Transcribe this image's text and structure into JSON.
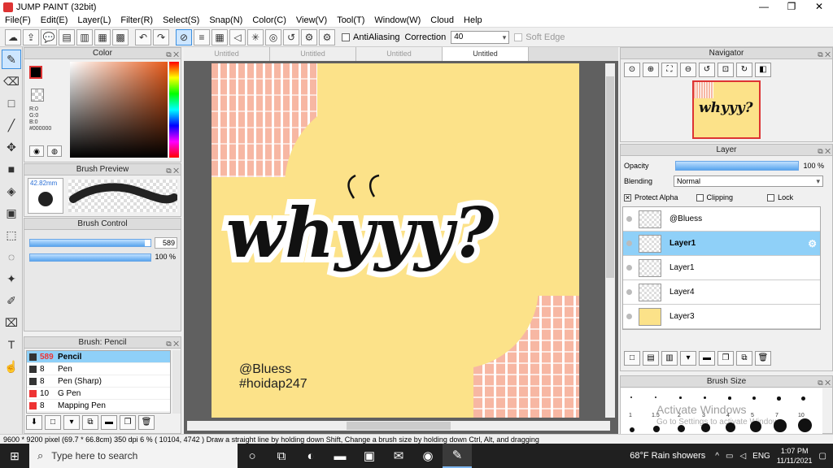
{
  "window": {
    "title": "JUMP PAINT (32bit)",
    "minimize": "—",
    "restore": "❐",
    "close": "✕"
  },
  "menu": [
    "File(F)",
    "Edit(E)",
    "Layer(L)",
    "Filter(R)",
    "Select(S)",
    "Snap(N)",
    "Color(C)",
    "View(V)",
    "Tool(T)",
    "Window(W)",
    "Cloud",
    "Help"
  ],
  "toolbar": {
    "antialiasing_label": "AntiAliasing",
    "correction_label": "Correction",
    "correction_value": "40",
    "soft_edge_label": "Soft Edge"
  },
  "color_panel": {
    "title": "Color",
    "r": "R:0",
    "g": "G:0",
    "b": "B:0",
    "hex": "#000000",
    "fg": "#000000",
    "bg": "#ffe680"
  },
  "brush_preview": {
    "title": "Brush Preview",
    "size": "42.82mm"
  },
  "brush_control": {
    "title": "Brush Control",
    "size_value": "589",
    "size_fraction": 0.95,
    "opacity_value": "100 %",
    "opacity_fraction": 1.0
  },
  "brush_list": {
    "title": "Brush: Pencil",
    "items": [
      {
        "size": "589",
        "name": "Pencil",
        "active": true
      },
      {
        "size": "8",
        "name": "Pen"
      },
      {
        "size": "8",
        "name": "Pen (Sharp)"
      },
      {
        "size": "10",
        "name": "G Pen"
      },
      {
        "size": "8",
        "name": "Mapping Pen"
      }
    ]
  },
  "canvas": {
    "tabs": [
      "Untitled",
      "Untitled",
      "Untitled",
      "Untitled"
    ],
    "active_tab": 3,
    "artwork_text": "whyyy?",
    "signature_line1": "@Bluess",
    "signature_line2": "#hoidap247"
  },
  "navigator": {
    "title": "Navigator",
    "thumb_text": "whyyy?"
  },
  "layer_panel": {
    "title": "Layer",
    "opacity_label": "Opacity",
    "opacity_value": "100 %",
    "opacity_fraction": 1.0,
    "blending_label": "Blending",
    "blending_value": "Normal",
    "protect_alpha_label": "Protect Alpha",
    "clipping_label": "Clipping",
    "lock_label": "Lock",
    "layers": [
      {
        "name": "@Bluess"
      },
      {
        "name": "Layer1",
        "active": true
      },
      {
        "name": "Layer1"
      },
      {
        "name": "Layer4"
      },
      {
        "name": "Layer3",
        "thumb": "yellow"
      }
    ]
  },
  "brush_size": {
    "title": "Brush Size",
    "labels": [
      "1",
      "1.5",
      "2",
      "3",
      "4",
      "5",
      "7",
      "10"
    ],
    "watermark_title": "Activate Windows",
    "watermark_sub": "Go to Settings to activate Windows."
  },
  "status": {
    "text": "9600 * 9200 pixel   (69.7 * 66.8cm)   350 dpi   6 %   ( 10104, 4742 )   Draw a straight line by holding down Shift, Change a brush size by holding down Ctrl, Alt, and dragging"
  },
  "taskbar": {
    "search_placeholder": "Type here to search",
    "weather": "68°F  Rain showers",
    "lang": "ENG",
    "time": "1:07 PM",
    "date": "11/11/2021"
  }
}
